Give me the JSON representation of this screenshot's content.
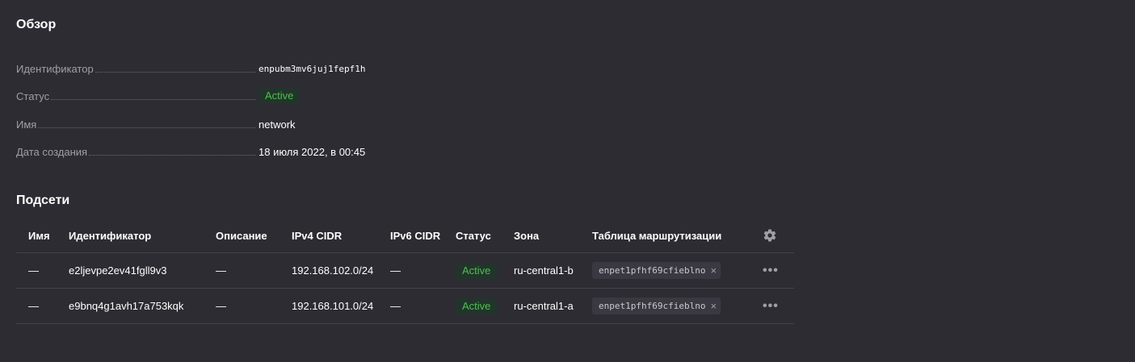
{
  "overview": {
    "title": "Обзор",
    "rows": [
      {
        "label": "Идентификатор",
        "value": "enpubm3mv6juj1fepf1h"
      },
      {
        "label": "Статус",
        "value": "Active"
      },
      {
        "label": "Имя",
        "value": "network"
      },
      {
        "label": "Дата создания",
        "value": "18 июля 2022, в 00:45"
      }
    ]
  },
  "subnets": {
    "title": "Подсети",
    "columns": [
      "Имя",
      "Идентификатор",
      "Описание",
      "IPv4 CIDR",
      "IPv6 CIDR",
      "Статус",
      "Зона",
      "Таблица маршрутизации"
    ],
    "rows": [
      {
        "name": "—",
        "id": "e2ljevpe2ev41fgll9v3",
        "description": "—",
        "ipv4": "192.168.102.0/24",
        "ipv6": "—",
        "status": "Active",
        "zone": "ru-central1-b",
        "route_table": "enpet1pfhf69cfieblno"
      },
      {
        "name": "—",
        "id": "e9bnq4g1avh17a753kqk",
        "description": "—",
        "ipv4": "192.168.101.0/24",
        "ipv6": "—",
        "status": "Active",
        "zone": "ru-central1-a",
        "route_table": "enpet1pfhf69cfieblno"
      }
    ]
  },
  "icons": {
    "settings": "gear-icon",
    "row_actions": "more-horizontal-icon",
    "chip_remove": "close-icon",
    "chip_close_glyph": "×",
    "more_glyph": "•••"
  },
  "colors": {
    "background": "#2d2c33",
    "active_text": "#4fbf4f",
    "active_bg": "#22352b",
    "label_text": "#a09fa6",
    "divider": "#45444b"
  }
}
